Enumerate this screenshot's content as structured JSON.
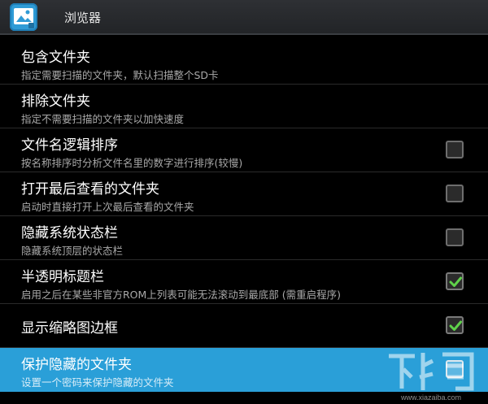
{
  "actionbar": {
    "title": "浏览器",
    "app_icon": "browser-app-icon"
  },
  "settings": [
    {
      "title": "包含文件夹",
      "subtitle": "指定需要扫描的文件夹，默认扫描整个SD卡",
      "checkbox": null
    },
    {
      "title": "排除文件夹",
      "subtitle": "指定不需要扫描的文件夹以加快速度",
      "checkbox": null
    },
    {
      "title": "文件名逻辑排序",
      "subtitle": "按名称排序时分析文件名里的数字进行排序(较慢)",
      "checkbox": false
    },
    {
      "title": "打开最后查看的文件夹",
      "subtitle": "启动时直接打开上次最后查看的文件夹",
      "checkbox": false
    },
    {
      "title": "隐藏系统状态栏",
      "subtitle": "隐藏系统顶层的状态栏",
      "checkbox": false
    },
    {
      "title": "半透明标题栏",
      "subtitle": "启用之后在某些非官方ROM上列表可能无法滚动到最底部 (需重启程序)",
      "checkbox": true
    },
    {
      "title": "显示缩略图边框",
      "subtitle": "",
      "checkbox": true
    },
    {
      "title": "保护隐藏的文件夹",
      "subtitle": "设置一个密码来保护隐藏的文件夹",
      "checkbox": false,
      "active": true
    }
  ],
  "colors": {
    "accent": "#2a9fd8",
    "check": "#5fd14a",
    "background": "#000000"
  },
  "watermark": {
    "logo_text": "下载吧",
    "url": "www.xiazaiba.com"
  }
}
